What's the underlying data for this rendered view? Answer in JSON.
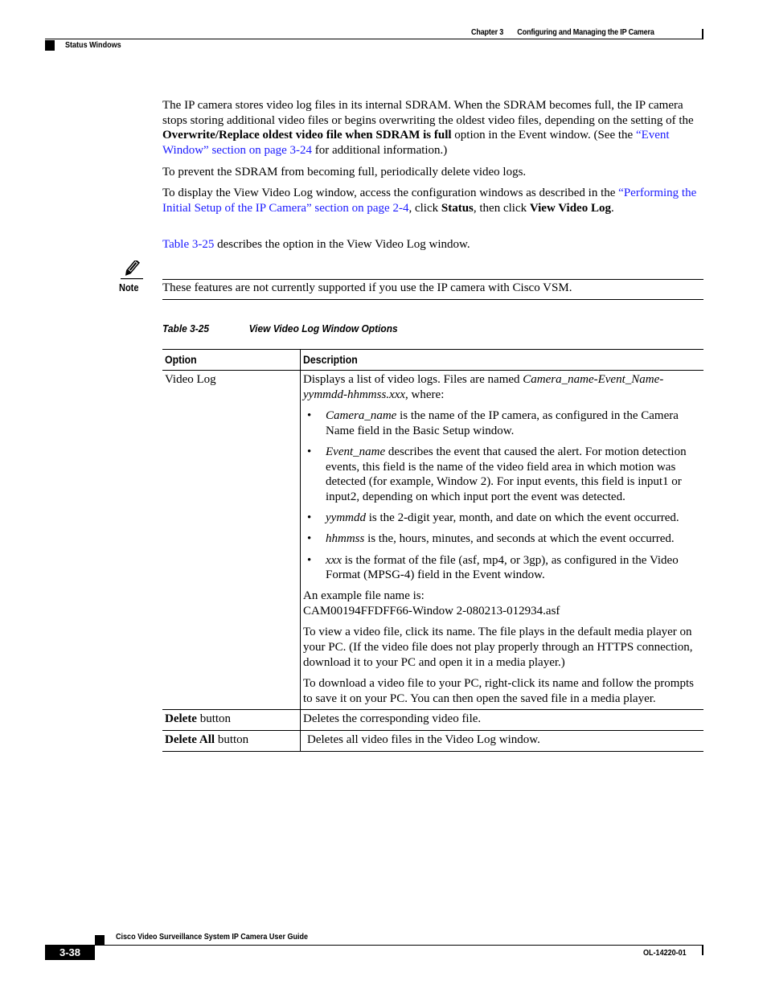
{
  "header": {
    "chapter": "Chapter 3",
    "chapter_title": "Configuring and Managing the IP Camera",
    "section": "Status Windows"
  },
  "body": {
    "p1": {
      "t1": "The IP camera stores video log files in its internal SDRAM. When the SDRAM becomes full, the IP camera stops storing additional video files or begins overwriting the oldest video files, depending on the setting of the ",
      "bold1": "Overwrite/Replace oldest video file when SDRAM is full",
      "t2": " option in the Event window. (See the ",
      "link1": "“Event Window” section on page 3-24",
      "t3": " for additional information.)"
    },
    "p2": "To prevent the SDRAM from becoming full, periodically delete video logs.",
    "p3": {
      "t1": "To display the View Video Log window, access the configuration windows as described in the ",
      "link1": "“Performing the Initial Setup of the IP Camera” section on page 2-4",
      "t2": ", click ",
      "bold1": "Status",
      "t3": ", then click ",
      "bold2": "View Video Log",
      "t4": "."
    },
    "p4": {
      "link1": "Table 3-25",
      "t1": " describes the option in the View Video Log window."
    }
  },
  "note": {
    "icon": "pencil-note-icon",
    "label": "Note",
    "text": "These features are not currently supported if you use the IP camera with Cisco VSM."
  },
  "table": {
    "caption_number": "Table 3-25",
    "caption_title": "View Video Log Window Options",
    "headers": [
      "Option",
      "Description"
    ],
    "video_log": {
      "option": "Video Log",
      "intro_t1": "Displays a list of video logs. Files are named ",
      "intro_italic": "Camera_name-Event_Name-yymmdd-hhmmss.xxx",
      "intro_t2": ", where:",
      "bullets": [
        {
          "term": "Camera_name",
          "text": " is the name of the IP camera, as configured in the Camera Name field in the Basic Setup window."
        },
        {
          "term": "Event_name",
          "text": " describes the event that caused the alert. For motion detection events, this field is the name of the video field area in which motion was detected (for example, Window 2). For input events, this field is input1 or input2, depending on which input port the event was detected."
        },
        {
          "term": "yymmdd",
          "text": " is the 2-digit year, month, and date on which the event occurred."
        },
        {
          "term": "hhmmss",
          "text": " is the, hours, minutes, and seconds at which the event occurred."
        },
        {
          "term": "xxx",
          "text": " is the format of the file (asf, mp4, or 3gp), as configured in the Video Format (MPSG-4) field in the Event window."
        }
      ],
      "example_label": "An example file name is:",
      "example_value": "CAM00194FFDFF66-Window 2-080213-012934.asf",
      "view_text": "To view a video file, click its name. The file plays in the default media player on your PC. (If the video file does not play properly through an HTTPS connection, download it to your PC and open it in a media player.)",
      "download_text": "To download a video file to your PC, right-click its name and follow the prompts to save it on your PC. You can then open the saved file in a media player."
    },
    "delete": {
      "option_bold": "Delete",
      "option_rest": " button",
      "description": "Deletes the corresponding video file."
    },
    "delete_all": {
      "option_bold": "Delete All",
      "option_rest": " button",
      "description": "Deletes all video files in the Video Log window."
    },
    "bullet_char": "•"
  },
  "footer": {
    "guide_title": "Cisco Video Surveillance System IP Camera User Guide",
    "page_number": "3-38",
    "doc_id": "OL-14220-01"
  }
}
